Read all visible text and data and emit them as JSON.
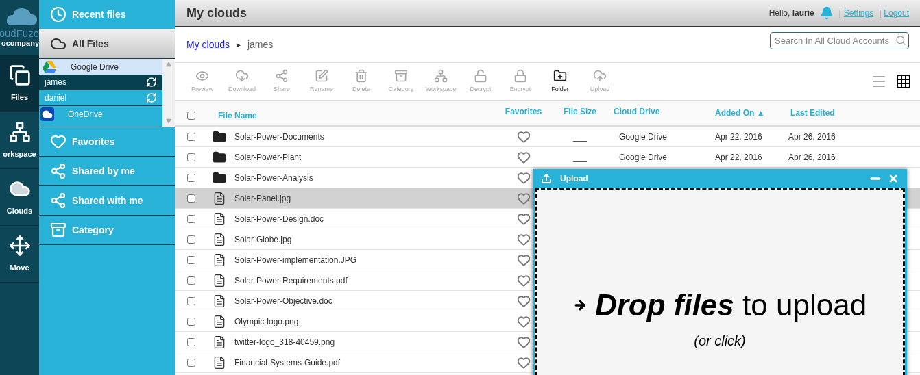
{
  "rail": {
    "logo_lines": [
      "oudFuze",
      "ocompany"
    ],
    "items": [
      {
        "kind": "files",
        "label": "Files",
        "selected": true
      },
      {
        "kind": "workspace",
        "label": "orkspace",
        "selected": false
      },
      {
        "kind": "clouds",
        "label": "Clouds",
        "selected": false
      },
      {
        "kind": "move",
        "label": "Move",
        "selected": false
      }
    ]
  },
  "sidebar": {
    "items": [
      {
        "kind": "recent",
        "label": "Recent files",
        "selected": false
      },
      {
        "kind": "all",
        "label": "All Files",
        "selected": true
      },
      {
        "kind": "favorites",
        "label": "Favorites",
        "selected": false
      },
      {
        "kind": "shared_by",
        "label": "Shared by me",
        "selected": false
      },
      {
        "kind": "shared_with",
        "label": "Shared with me",
        "selected": false
      },
      {
        "kind": "category",
        "label": "Category",
        "selected": false
      }
    ],
    "clouds": [
      {
        "kind": "google",
        "label": "Google Drive",
        "selected": true,
        "accounts": [
          {
            "label": "james",
            "selected": true
          },
          {
            "label": "daniel",
            "selected": false
          }
        ]
      },
      {
        "kind": "onedrive",
        "label": "OneDrive",
        "selected": false
      }
    ]
  },
  "header": {
    "title": "My clouds",
    "greeting": "Hello, ",
    "user": "laurie",
    "links": [
      "Settings",
      "Logout"
    ],
    "separator": "|"
  },
  "breadcrumb": {
    "link": "My clouds",
    "separator": "►",
    "current": "james"
  },
  "search": {
    "placeholder": "Search In All Cloud Accounts"
  },
  "toolbar": [
    {
      "kind": "preview",
      "label": "Preview",
      "disabled": true
    },
    {
      "kind": "download",
      "label": "Download",
      "disabled": true
    },
    {
      "kind": "share",
      "label": "Share",
      "disabled": true
    },
    {
      "kind": "rename",
      "label": "Rename",
      "disabled": true
    },
    {
      "kind": "delete",
      "label": "Delete",
      "disabled": true
    },
    {
      "kind": "category",
      "label": "Category",
      "disabled": true
    },
    {
      "kind": "workspace",
      "label": "Workspace",
      "disabled": true
    },
    {
      "kind": "decrypt",
      "label": "Decrypt",
      "disabled": true
    },
    {
      "kind": "encrypt",
      "label": "Encrypt",
      "disabled": true
    },
    {
      "kind": "folder",
      "label": "Folder",
      "disabled": false
    },
    {
      "kind": "upload",
      "label": "Upload",
      "disabled": true
    }
  ],
  "view_modes": [
    {
      "kind": "list",
      "selected": false
    },
    {
      "kind": "grid",
      "selected": true
    }
  ],
  "table": {
    "select_all_checked": false,
    "columns": [
      "File Name",
      "Favorites",
      "File Size",
      "Cloud Drive",
      "Added On ▲",
      "Last Edited"
    ],
    "rows": [
      {
        "kind": "folder",
        "name": "Solar-Power-Documents",
        "selected": false,
        "checked": false,
        "size": "___",
        "drive": "Google Drive",
        "added": "Apr 22, 2016",
        "edited": "Apr 26, 2016"
      },
      {
        "kind": "folder",
        "name": "Solar-Power-Plant",
        "selected": false,
        "checked": false,
        "size": "___",
        "drive": "Google Drive",
        "added": "Apr 22, 2016",
        "edited": "Apr 26, 2016"
      },
      {
        "kind": "folder",
        "name": "Solar-Power-Analysis",
        "selected": false,
        "checked": false
      },
      {
        "kind": "file",
        "name": "Solar-Panel.jpg",
        "selected": true,
        "checked": false
      },
      {
        "kind": "file",
        "name": "Solar-Power-Design.doc",
        "selected": false,
        "checked": false
      },
      {
        "kind": "file",
        "name": "Solar-Globe.jpg",
        "selected": false,
        "checked": false
      },
      {
        "kind": "file",
        "name": "Solar-Power-implementation.JPG",
        "selected": false,
        "checked": false
      },
      {
        "kind": "file",
        "name": "Solar-Power-Requirements.pdf",
        "selected": false,
        "checked": false
      },
      {
        "kind": "file",
        "name": "Solar-Power-Objective.doc",
        "selected": false,
        "checked": false
      },
      {
        "kind": "file",
        "name": "Olympic-logo.png",
        "selected": false,
        "checked": false
      },
      {
        "kind": "file",
        "name": "twitter-logo_318-40459.png",
        "selected": false,
        "checked": false
      },
      {
        "kind": "file",
        "name": "Financial-Systems-Guide.pdf",
        "selected": false,
        "checked": false
      }
    ]
  },
  "upload_panel": {
    "title": "Upload",
    "drop_bold": "Drop files",
    "drop_rest": "to upload",
    "hint": "(or click)"
  }
}
